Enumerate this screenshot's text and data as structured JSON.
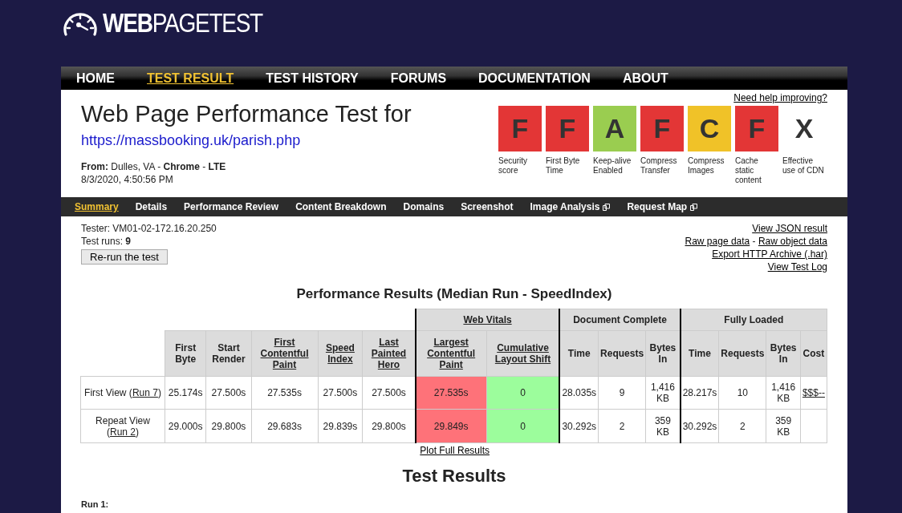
{
  "logo": {
    "text_bold": "WEB",
    "text_light": "PAGETEST"
  },
  "nav": [
    {
      "label": "HOME",
      "selected": false
    },
    {
      "label": "TEST RESULT",
      "selected": true
    },
    {
      "label": "TEST HISTORY",
      "selected": false
    },
    {
      "label": "FORUMS",
      "selected": false
    },
    {
      "label": "DOCUMENTATION",
      "selected": false
    },
    {
      "label": "ABOUT",
      "selected": false
    }
  ],
  "heading": {
    "title": "Web Page Performance Test for",
    "url": "https://massbooking.uk/parish.php",
    "from": "**From:** Dulles, VA - **Chrome** - **LTE**",
    "date": "8/3/2020, 4:50:56 PM"
  },
  "help_link": "Need help improving?",
  "grades": [
    {
      "grade": "F",
      "label": "Security score",
      "color": "#e33636"
    },
    {
      "grade": "F",
      "label": "First Byte Time",
      "color": "#e33636"
    },
    {
      "grade": "A",
      "label": "Keep-alive Enabled",
      "color": "#9acd50"
    },
    {
      "grade": "F",
      "label": "Compress Transfer",
      "color": "#e33636"
    },
    {
      "grade": "C",
      "label": "Compress Images",
      "color": "#f0c228"
    },
    {
      "grade": "F",
      "label": "Cache static content",
      "color": "#e33636"
    },
    {
      "grade": "X",
      "label": "Effective use of CDN"
    }
  ],
  "tabs": [
    {
      "label": "Summary",
      "selected": true,
      "external": false
    },
    {
      "label": "Details",
      "selected": false,
      "external": false
    },
    {
      "label": "Performance Review",
      "selected": false,
      "external": false
    },
    {
      "label": "Content Breakdown",
      "selected": false,
      "external": false
    },
    {
      "label": "Domains",
      "selected": false,
      "external": false
    },
    {
      "label": "Screenshot",
      "selected": false,
      "external": false
    },
    {
      "label": "Image Analysis",
      "selected": false,
      "external": true
    },
    {
      "label": "Request Map",
      "selected": false,
      "external": true
    }
  ],
  "info": {
    "tester": "Tester: VM01-02-172.16.20.250",
    "runs": "Test runs: **9**",
    "rerun_button": "Re-run the test"
  },
  "links": {
    "json": "View JSON result",
    "raw_page": "Raw page data",
    "separator": "-",
    "raw_object": "Raw object data",
    "har": "Export HTTP Archive (.har)",
    "log": "View Test Log"
  },
  "results": {
    "title": "Performance Results (Median Run - SpeedIndex)",
    "groups": [
      {
        "columns": [
          {
            "label": "First Byte",
            "link": false
          },
          {
            "label": "Start Render",
            "link": false
          },
          {
            "label": "First Contentful Paint",
            "link": true
          },
          {
            "label": "Speed Index",
            "link": true
          },
          {
            "label": "Last Painted Hero",
            "link": true
          }
        ]
      },
      {
        "label": "Web Vitals",
        "link": true,
        "columns": [
          {
            "label": "Largest Contentful Paint",
            "link": true
          },
          {
            "label": "Cumulative Layout Shift",
            "link": true
          }
        ]
      },
      {
        "label": "Document Complete",
        "link": false,
        "columns": [
          {
            "label": "Time",
            "link": false
          },
          {
            "label": "Requests",
            "link": false
          },
          {
            "label": "Bytes In",
            "link": false
          }
        ]
      },
      {
        "label": "Fully Loaded",
        "link": false,
        "columns": [
          {
            "label": "Time",
            "link": false
          },
          {
            "label": "Requests",
            "link": false
          },
          {
            "label": "Bytes In",
            "link": false
          },
          {
            "label": "Cost",
            "link": false
          }
        ]
      }
    ],
    "rows": [
      {
        "label_before": "First View (",
        "run": "Run 7",
        "label_after": ")",
        "cells": [
          {
            "value": "25.174s"
          },
          {
            "value": "27.500s"
          },
          {
            "value": "27.535s"
          },
          {
            "value": "27.500s"
          },
          {
            "value": "27.500s"
          },
          {
            "value": "27.535s",
            "color": "#fe7279"
          },
          {
            "value": "0",
            "color": "#9cfd9c"
          },
          {
            "value": "28.035s"
          },
          {
            "value": "9"
          },
          {
            "value": "1,416 KB"
          },
          {
            "value": "28.217s"
          },
          {
            "value": "10"
          },
          {
            "value": "1,416 KB"
          },
          {
            "value": "$$$--",
            "kind": "link"
          }
        ]
      },
      {
        "label_before": "Repeat View (",
        "run": "Run 2",
        "label_after": ")",
        "cells": [
          {
            "value": "29.000s"
          },
          {
            "value": "29.800s"
          },
          {
            "value": "29.683s"
          },
          {
            "value": "29.839s"
          },
          {
            "value": "29.800s"
          },
          {
            "value": "29.849s",
            "color": "#fe7279"
          },
          {
            "value": "0",
            "color": "#9cfd9c"
          },
          {
            "value": "30.292s"
          },
          {
            "value": "2"
          },
          {
            "value": "359 KB"
          },
          {
            "value": "30.292s"
          },
          {
            "value": "2"
          },
          {
            "value": "359 KB"
          }
        ]
      }
    ],
    "plot_link": "Plot Full Results"
  },
  "test_results_title": "Test Results",
  "run_label": "Run 1:"
}
